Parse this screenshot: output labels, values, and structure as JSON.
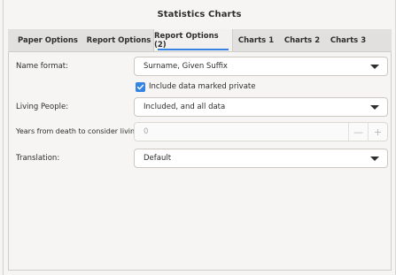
{
  "window": {
    "title": "Statistics Charts"
  },
  "tabs": [
    {
      "label": "Paper Options"
    },
    {
      "label": "Report Options"
    },
    {
      "label": "Report Options (2)",
      "active": true
    },
    {
      "label": "Charts 1"
    },
    {
      "label": "Charts 2"
    },
    {
      "label": "Charts 3"
    }
  ],
  "form": {
    "name_format": {
      "label": "Name format:",
      "value": "Surname, Given Suffix"
    },
    "private": {
      "label": "Include data marked private",
      "checked": true
    },
    "living": {
      "label": "Living People:",
      "value": "Included, and all data"
    },
    "years": {
      "label": "Years from death to consider living:",
      "value": "0",
      "minus": "—",
      "plus": "+"
    },
    "translation": {
      "label": "Translation:",
      "value": "Default"
    }
  },
  "colors": {
    "accent": "#3584e4"
  }
}
